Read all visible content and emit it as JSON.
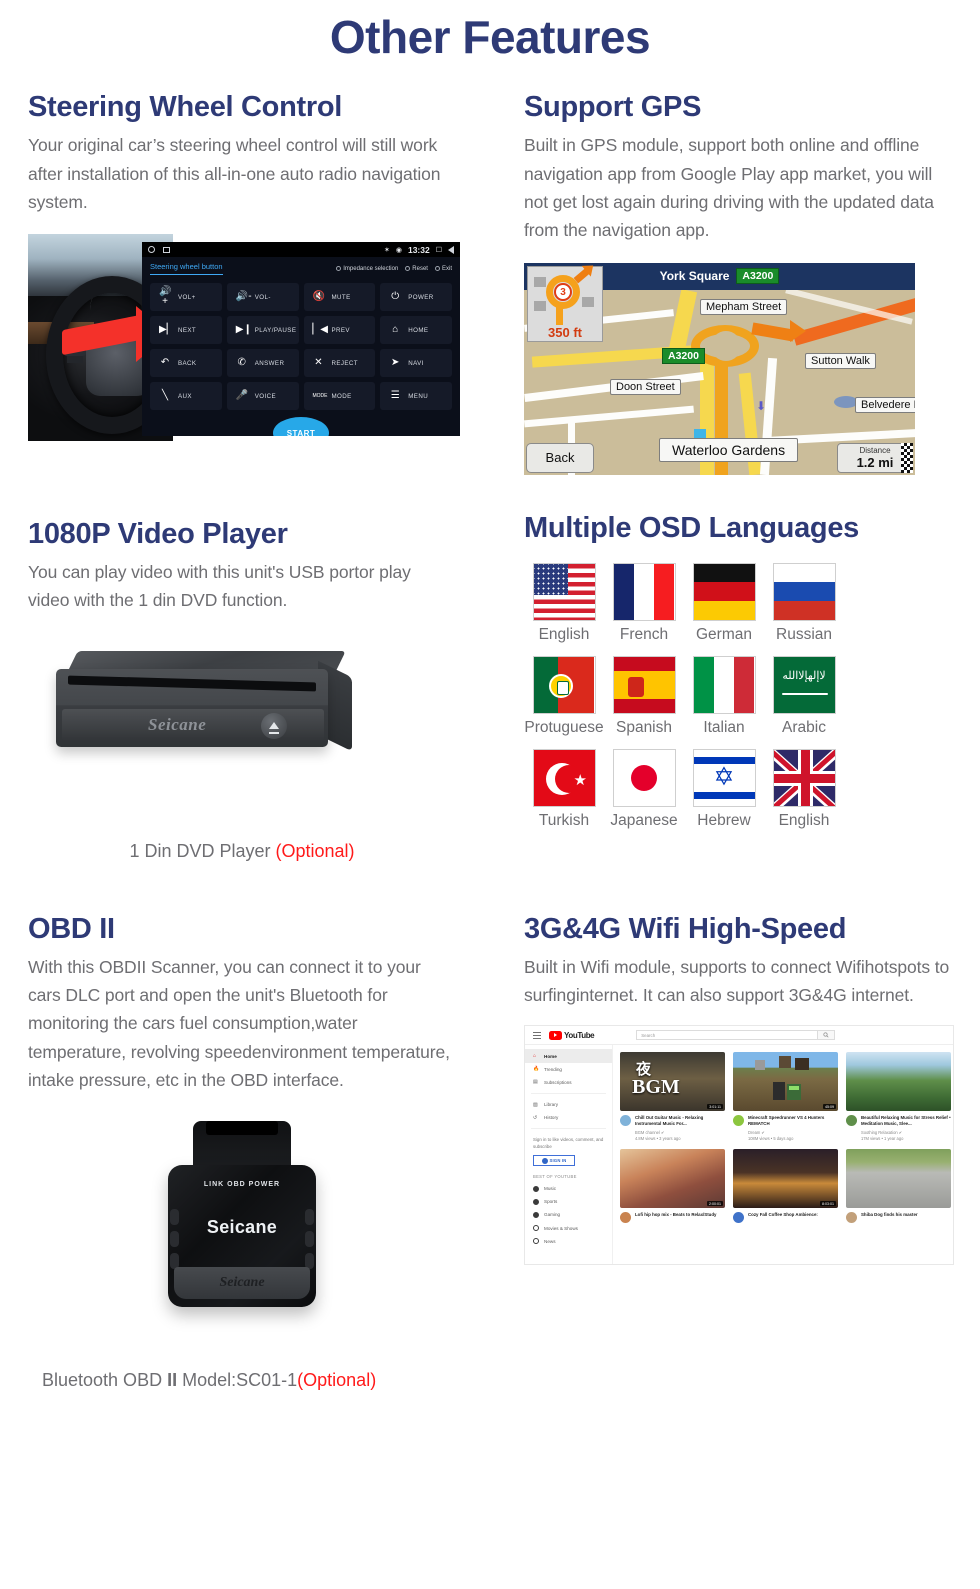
{
  "page": {
    "title": "Other Features"
  },
  "sections": [
    {
      "id": "steering-wheel-control",
      "title": "Steering Wheel Control",
      "body": "Your original car’s steering wheel control will still work after installation of this all-in-one auto radio navigation system."
    },
    {
      "id": "support-gps",
      "title": "Support GPS",
      "body": "Built in GPS module, support both online and offline navigation app from Google Play app market, you will not get lost again during driving with the updated data from the navigation app."
    },
    {
      "id": "video-player",
      "title": "1080P Video Player",
      "body": "You can play video with this unit's  USB portor play video with the 1 din DVD function.",
      "caption": "1 Din DVD Player ",
      "caption_optional": "(Optional)"
    },
    {
      "id": "osd-languages",
      "title": "Multiple OSD Languages"
    },
    {
      "id": "obd-ii",
      "title": "OBD II",
      "body": "With this OBDII Scanner, you can connect it to your cars DLC port and open the unit's Bluetooth for monitoring the cars fuel consumption,water temperature, revolving speedenvironment temperature, intake pressure, etc in the OBD interface.",
      "caption": "Bluetooth OBD ",
      "caption_mark": "II",
      "caption_model": " Model:SC01-1",
      "caption_optional": "(Optional)"
    },
    {
      "id": "wifi",
      "title": "3G&4G Wifi High-Speed",
      "body": "Built in Wifi module, supports to connect  Wifihotspots to surfinginternet. It can also support 3G&4G internet."
    }
  ],
  "steering_ui": {
    "status": {
      "clock": "13:32",
      "bluetooth_icon": "bluetooth-icon",
      "location_icon": "location-icon",
      "recents_icon": "recents-icon",
      "back_icon": "back-icon",
      "home_icon": "home-circle-icon",
      "apps_icon": "apps-icon"
    },
    "tab": "Steering wheel button",
    "tools": [
      "Impedance selection",
      "Reset",
      "Exit"
    ],
    "buttons": [
      {
        "icon": "volume-up-icon",
        "glyph": "🔊+",
        "label": "VOL+"
      },
      {
        "icon": "volume-down-icon",
        "glyph": "🔊-",
        "label": "VOL-"
      },
      {
        "icon": "mute-icon",
        "glyph": "🔇",
        "label": "MUTE"
      },
      {
        "icon": "power-icon",
        "glyph": "⏻",
        "label": "POWER"
      },
      {
        "icon": "next-track-icon",
        "glyph": "▶▏",
        "label": "NEXT"
      },
      {
        "icon": "play-pause-icon",
        "glyph": "▶❙",
        "label": "PLAY/PAUSE"
      },
      {
        "icon": "prev-track-icon",
        "glyph": "▏◀",
        "label": "PREV"
      },
      {
        "icon": "home-icon",
        "glyph": "⌂",
        "label": "HOME"
      },
      {
        "icon": "back-icon",
        "glyph": "↶",
        "label": "BACK"
      },
      {
        "icon": "answer-call-icon",
        "glyph": "✆",
        "label": "ANSWER"
      },
      {
        "icon": "reject-call-icon",
        "glyph": "✕",
        "label": "REJECT"
      },
      {
        "icon": "navi-icon",
        "glyph": "➤",
        "label": "NAVI"
      },
      {
        "icon": "aux-icon",
        "glyph": "╲",
        "label": "AUX"
      },
      {
        "icon": "voice-icon",
        "glyph": "🎤",
        "label": "VOICE"
      },
      {
        "icon": "mode-icon",
        "glyph": "MODE",
        "label": "MODE"
      },
      {
        "icon": "menu-icon",
        "glyph": "☰",
        "label": "MENU"
      }
    ],
    "start_label": "START"
  },
  "gps_map": {
    "header_street": "York Square",
    "header_shield": "A3200",
    "turn_exit_number": "3",
    "turn_distance": "350 ft",
    "labels": [
      "Mepham Street",
      "Sutton Walk",
      "Doon Street",
      "Belvedere Rd",
      "Waterloo Gardens"
    ],
    "road_shield": "A3200",
    "back_button": "Back",
    "distance_key": "Distance",
    "distance_value": "1.2 mi"
  },
  "dvd_player": {
    "brand": "Seicane",
    "eject_icon": "eject-icon"
  },
  "flags": [
    [
      {
        "code": "us",
        "label": "English"
      },
      {
        "code": "fr",
        "label": "French"
      },
      {
        "code": "de",
        "label": "German"
      },
      {
        "code": "ru",
        "label": "Russian"
      }
    ],
    [
      {
        "code": "pt",
        "label": "Protuguese"
      },
      {
        "code": "es",
        "label": "Spanish"
      },
      {
        "code": "it",
        "label": "Italian"
      },
      {
        "code": "sa",
        "label": "Arabic"
      }
    ],
    [
      {
        "code": "tr",
        "label": "Turkish"
      },
      {
        "code": "jp",
        "label": "Japanese"
      },
      {
        "code": "il",
        "label": "Hebrew"
      },
      {
        "code": "gb",
        "label": "English"
      }
    ]
  ],
  "obd_device": {
    "leds": "LINK   OBD  POWER",
    "brand": "Seicane",
    "foot_brand": "Seicane"
  },
  "youtube": {
    "wordmark": "YouTube",
    "search_placeholder": "Search",
    "nav": [
      "Home",
      "Trending",
      "Subscriptions",
      "Library",
      "History"
    ],
    "signin_note": "Sign in to like videos, comment, and subscribe",
    "signin_button": "SIGN IN",
    "best_header": "BEST OF YOUTUBE",
    "best_items": [
      "Music",
      "Sports",
      "Gaming",
      "Movies & Shows",
      "News"
    ],
    "videos": [
      {
        "title": "Chill Out Guitar Music - Relaxing Instrumental Music For...",
        "channel": "BGM channel",
        "views": "4.8M views • 3 years ago",
        "duration": "3:01:11",
        "thumb": "bgm"
      },
      {
        "title": "Minecraft Speedrunner VS 4 Hunters REMATCH",
        "channel": "Dream",
        "views": "108M views • 5 days ago",
        "duration": "45:09",
        "thumb": "minecraft"
      },
      {
        "title": "Beautiful Relaxing Music for Stress Relief • Meditation Music, Slee...",
        "channel": "Soothing Relaxation",
        "views": "17M views • 1 year ago",
        "duration": "",
        "thumb": "nature"
      },
      {
        "title": "Lofi hip hop mix - Beats to Relax/Study",
        "channel": "",
        "views": "",
        "duration": "2:00:01",
        "thumb": "lofi"
      },
      {
        "title": "Cozy Fall Coffee Shop Ambience:",
        "channel": "",
        "views": "",
        "duration": "8:03:01",
        "thumb": "cafe"
      },
      {
        "title": "Shiba Dog finds his master",
        "channel": "",
        "views": "",
        "duration": "",
        "thumb": "dog"
      }
    ]
  }
}
